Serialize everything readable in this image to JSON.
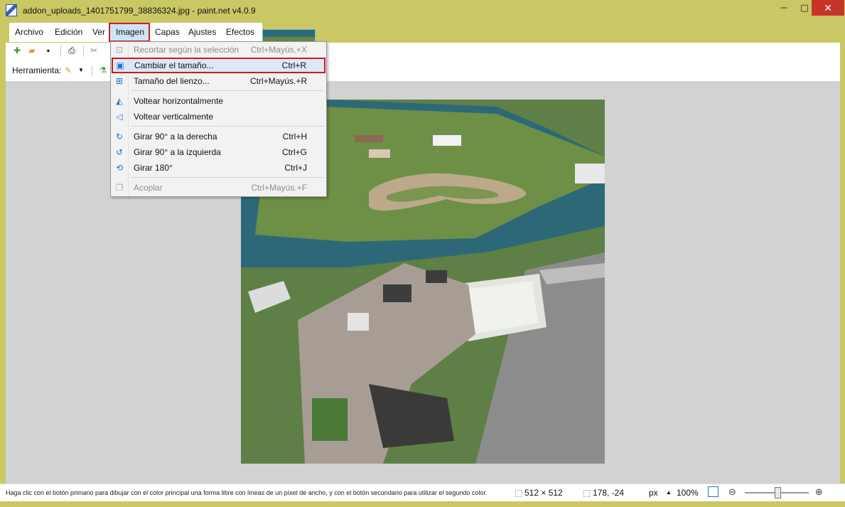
{
  "window": {
    "title": "addon_uploads_1401751799_38836324.jpg - paint.net v4.0.9",
    "minimize": "─",
    "maximize": "▢",
    "close": "✕"
  },
  "menu": {
    "archivo": "Archivo",
    "edicion": "Edición",
    "ver": "Ver",
    "imagen": "Imagen",
    "capas": "Capas",
    "ajustes": "Ajustes",
    "efectos": "Efectos"
  },
  "toolbar": {
    "tool_label": "Herramienta:"
  },
  "imagen_menu": {
    "items": [
      {
        "label": "Recortar según la selección",
        "shortcut": "Ctrl+Mayús.+X",
        "enabled": false
      },
      {
        "label": "Cambiar el tamaño...",
        "shortcut": "Ctrl+R",
        "enabled": true
      },
      {
        "label": "Tamaño del lienzo...",
        "shortcut": "Ctrl+Mayús.+R",
        "enabled": true
      },
      {
        "label": "Voltear horizontalmente",
        "shortcut": "",
        "enabled": true
      },
      {
        "label": "Voltear verticalmente",
        "shortcut": "",
        "enabled": true
      },
      {
        "label": "Girar 90° a la derecha",
        "shortcut": "Ctrl+H",
        "enabled": true
      },
      {
        "label": "Girar 90° a la izquierda",
        "shortcut": "Ctrl+G",
        "enabled": true
      },
      {
        "label": "Girar 180°",
        "shortcut": "Ctrl+J",
        "enabled": true
      },
      {
        "label": "Acoplar",
        "shortcut": "Ctrl+Mayús.+F",
        "enabled": false
      }
    ]
  },
  "status": {
    "hint": "Haga clic con el botón primario para dibujar con el color principal una forma libre con líneas de un píxel de ancho, y con el botón secundario para utilizar el segundo color.",
    "image_size": "512 × 512",
    "cursor_position": "178, -24",
    "unit": "px",
    "zoom": "100%"
  },
  "colors": {
    "frame": "#c9c865",
    "highlight_border": "#d11a1a",
    "close_button": "#c7352a"
  }
}
